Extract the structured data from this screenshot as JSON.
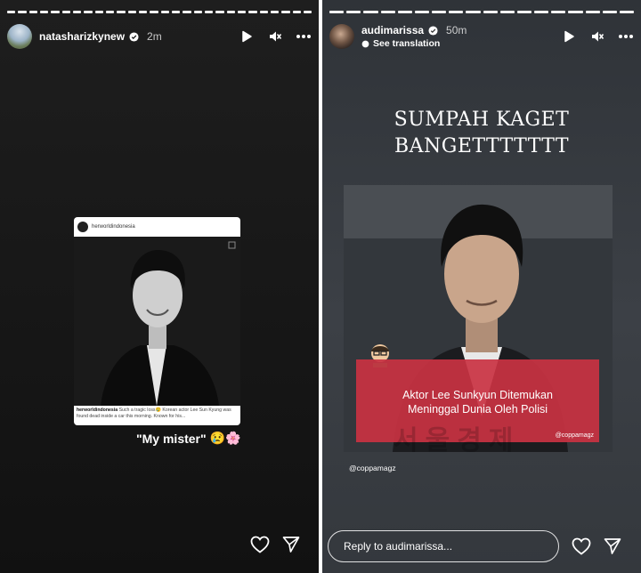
{
  "left_story": {
    "username": "natasharizkynew",
    "time": "2m",
    "card": {
      "account": "herworldindonesia",
      "caption_user": "herworldindonesia",
      "caption_text": "Such a tragic loss😢 Korean actor Lee Sun Kyung was found dead inside a car this morning. Known for his..."
    },
    "sticker_text": "\"My mister\"",
    "emojis": "😢🌸"
  },
  "right_story": {
    "username": "audimarissa",
    "time": "50m",
    "see_translation": "See translation",
    "headline_line1": "SUMPAH KAGET",
    "headline_line2": "BANGETTTTTTT",
    "news_line1": "Aktor Lee Sunkyun Ditemukan",
    "news_line2": "Meninggal Dunia Oleh Polisi",
    "banner_tag": "@coppamagz",
    "korean_watermark": "서울경제",
    "mention": "@coppamagz",
    "reply_placeholder": "Reply to audimarissa..."
  },
  "icons": [
    "verified-icon",
    "play-icon",
    "mute-icon",
    "more-icon",
    "heart-icon",
    "send-icon",
    "translate-icon"
  ],
  "colors": {
    "banner_red": "#c93242",
    "verified_blue": "#ffffff"
  }
}
